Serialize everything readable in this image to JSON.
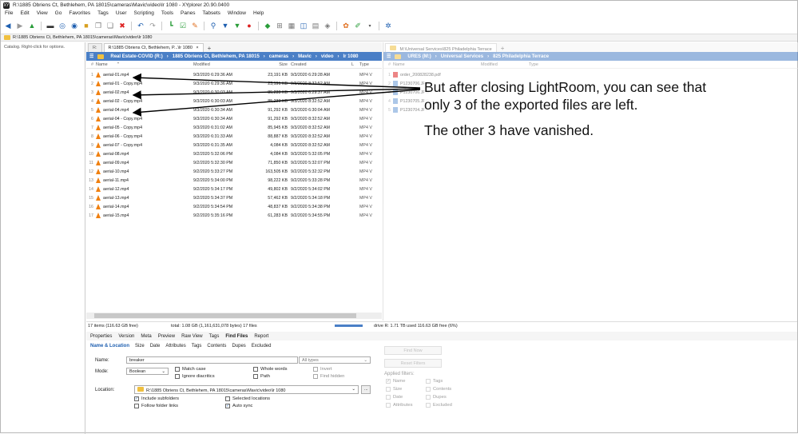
{
  "window": {
    "title": "R:\\1885 Obriens Ct, Bethlehem, PA 18015\\cameras\\Mavic\\video\\lr 1080 - XYplorer 20.90.0400",
    "app_icon": "XY"
  },
  "menu": [
    "File",
    "Edit",
    "View",
    "Go",
    "Favorites",
    "Tags",
    "User",
    "Scripting",
    "Tools",
    "Panes",
    "Tabsets",
    "Window",
    "Help"
  ],
  "address": "R:\\1885 Obriens Ct, Bethlehem, PA 18015\\cameras\\Mavic\\video\\lr 1080",
  "tree": {
    "hint": "Catalog. Right-click for options."
  },
  "pane1": {
    "tabs": [
      {
        "label": "R:\\1885 Obriens Ct, Bethlehem, P...\\lr 1080",
        "close": "×"
      }
    ],
    "tab_first": "R:",
    "breadcrumb": [
      "Real Estate-COVID (R:)",
      "1885 Obriens Ct, Bethlehem, PA 18015",
      "cameras",
      "Mavic",
      "video",
      "lr 1080"
    ],
    "columns": {
      "num": "#",
      "name": "Name",
      "modified": "Modified",
      "size": "Size",
      "created": "Created",
      "l": "L",
      "type": "Type"
    },
    "files": [
      {
        "n": "1",
        "name": "aerial-01.mp4",
        "modified": "9/3/2020 6:29:36 AM",
        "size": "23,191 KB",
        "created": "9/3/2020 6:29:28 AM",
        "type": "MP4 V"
      },
      {
        "n": "2",
        "name": "aerial-01 - Copy.mp4",
        "modified": "9/3/2020 6:29:36 AM",
        "size": "23,191 KB",
        "created": "9/3/2020 8:32:52 AM",
        "type": "MP4 V"
      },
      {
        "n": "3",
        "name": "aerial-02.mp4",
        "modified": "9/3/2020 6:30:03 AM",
        "size": "85,233 KB",
        "created": "9/3/2020 6:29:37 AM",
        "type": "MP4 V"
      },
      {
        "n": "4",
        "name": "aerial-02 - Copy.mp4",
        "modified": "9/3/2020 6:30:03 AM",
        "size": "85,233 KB",
        "created": "9/3/2020 8:32:52 AM",
        "type": "MP4 V"
      },
      {
        "n": "5",
        "name": "aerial-04.mp4",
        "modified": "9/3/2020 6:30:34 AM",
        "size": "91,292 KB",
        "created": "9/3/2020 6:30:04 AM",
        "type": "MP4 V"
      },
      {
        "n": "6",
        "name": "aerial-04 - Copy.mp4",
        "modified": "9/3/2020 6:30:34 AM",
        "size": "91,292 KB",
        "created": "9/3/2020 8:32:52 AM",
        "type": "MP4 V"
      },
      {
        "n": "7",
        "name": "aerial-05 - Copy.mp4",
        "modified": "9/3/2020 6:31:02 AM",
        "size": "85,945 KB",
        "created": "9/3/2020 8:32:52 AM",
        "type": "MP4 V"
      },
      {
        "n": "8",
        "name": "aerial-06 - Copy.mp4",
        "modified": "9/3/2020 6:31:33 AM",
        "size": "88,887 KB",
        "created": "9/3/2020 8:32:52 AM",
        "type": "MP4 V"
      },
      {
        "n": "9",
        "name": "aerial-07 - Copy.mp4",
        "modified": "9/3/2020 6:31:35 AM",
        "size": "4,084 KB",
        "created": "9/3/2020 8:32:52 AM",
        "type": "MP4 V"
      },
      {
        "n": "10",
        "name": "aerial-08.mp4",
        "modified": "9/2/2020 5:32:06 PM",
        "size": "4,084 KB",
        "created": "9/3/2020 5:32:05 PM",
        "type": "MP4 V"
      },
      {
        "n": "11",
        "name": "aerial-09.mp4",
        "modified": "9/2/2020 5:32:30 PM",
        "size": "71,850 KB",
        "created": "9/2/2020 5:32:07 PM",
        "type": "MP4 V"
      },
      {
        "n": "12",
        "name": "aerial-10.mp4",
        "modified": "9/2/2020 5:33:27 PM",
        "size": "163,505 KB",
        "created": "9/2/2020 5:32:32 PM",
        "type": "MP4 V"
      },
      {
        "n": "13",
        "name": "aerial-11.mp4",
        "modified": "9/2/2020 5:34:00 PM",
        "size": "98,222 KB",
        "created": "9/2/2020 5:33:28 PM",
        "type": "MP4 V"
      },
      {
        "n": "14",
        "name": "aerial-12.mp4",
        "modified": "9/2/2020 5:34:17 PM",
        "size": "49,802 KB",
        "created": "9/2/2020 5:34:02 PM",
        "type": "MP4 V"
      },
      {
        "n": "15",
        "name": "aerial-13.mp4",
        "modified": "9/2/2020 5:34:37 PM",
        "size": "57,462 KB",
        "created": "9/2/2020 5:34:18 PM",
        "type": "MP4 V"
      },
      {
        "n": "16",
        "name": "aerial-14.mp4",
        "modified": "9/2/2020 5:34:54 PM",
        "size": "48,837 KB",
        "created": "9/2/2020 5:34:38 PM",
        "type": "MP4 V"
      },
      {
        "n": "17",
        "name": "aerial-15.mp4",
        "modified": "9/2/2020 5:35:16 PM",
        "size": "61,283 KB",
        "created": "9/2/2020 5:34:55 PM",
        "type": "MP4 V"
      }
    ]
  },
  "pane2": {
    "tab": "M:\\Universal Services\\825 Philadelphia Terrace",
    "breadcrumb": [
      "URES (M:)",
      "Universal Services",
      "825 Philadelphia Terrace"
    ],
    "columns": {
      "num": "#",
      "name": "Name",
      "modified": "Modified",
      "type": "Type"
    },
    "files": [
      {
        "n": "1",
        "name": "order_200828238.pdf"
      },
      {
        "n": "2",
        "name": "P1230706.JPG"
      },
      {
        "n": "3",
        "name": "P1230706.JPG"
      },
      {
        "n": "4",
        "name": "P1230705.JPG"
      },
      {
        "n": "5",
        "name": "P1230704.JPG"
      }
    ]
  },
  "status": {
    "items": "17 items (116.63 GB free)",
    "total": "total: 1.08 GB (1,161,631,078 bytes)  17 files",
    "drive": "drive R:  1.71 TB used  116.63 GB free (6%)"
  },
  "info_tabs": [
    "Properties",
    "Version",
    "Meta",
    "Preview",
    "Raw View",
    "Tags",
    "Find Files",
    "Report"
  ],
  "info_tab_active": "Find Files",
  "find_tabs": [
    "Name & Location",
    "Size",
    "Date",
    "Attributes",
    "Tags",
    "Contents",
    "Dupes",
    "Excluded"
  ],
  "find_tab_active": "Name & Location",
  "find": {
    "name_label": "Name:",
    "name_value": "breaker",
    "types_value": "All types",
    "mode_label": "Mode:",
    "mode_value": "Boolean",
    "location_label": "Location:",
    "location_value": "R:\\1885 Obriens Ct, Bethlehem, PA 18015\\cameras\\Mavic\\video\\lr 1080",
    "browse": "...",
    "options": {
      "match_case": {
        "label": "Match case",
        "checked": false
      },
      "ignore_diacritics": {
        "label": "Ignore diacritics",
        "checked": false
      },
      "whole_words": {
        "label": "Whole words",
        "checked": false
      },
      "path": {
        "label": "Path",
        "checked": false
      },
      "invert": {
        "label": "Invert",
        "checked": false
      },
      "find_hidden": {
        "label": "Find hidden",
        "checked": false
      },
      "include_subfolders": {
        "label": "Include subfolders",
        "checked": true
      },
      "follow_folder_links": {
        "label": "Follow folder links",
        "checked": false
      },
      "selected_locations": {
        "label": "Selected locations",
        "checked": false
      },
      "auto_sync": {
        "label": "Auto sync",
        "checked": true
      }
    },
    "buttons": {
      "find_now": "Find Now",
      "reset_filters": "Reset Filters"
    },
    "applied_filters": {
      "title": "Applied filters:",
      "items": [
        "Name",
        "Tags",
        "Size",
        "Contents",
        "Date",
        "Dupes",
        "Attributes",
        "Excluded"
      ]
    }
  },
  "callout": {
    "line1": "But after closing LightRoom, you can see that only 3 of the exported files are left.",
    "line2": "The other 3 have vanished."
  },
  "colors": {
    "accent": "#4a7fc6",
    "vlc_orange": "#f08010",
    "folder": "#f0c040"
  }
}
